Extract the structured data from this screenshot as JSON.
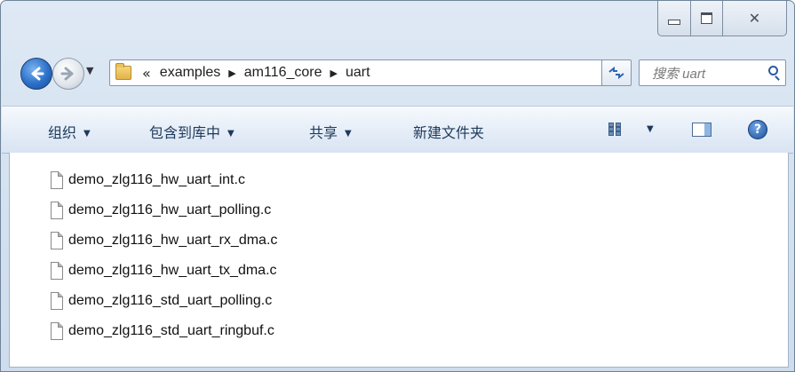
{
  "window": {
    "caption": {
      "minimize": "minimize",
      "maximize": "maximize",
      "close": "close"
    }
  },
  "address_bar": {
    "overflow": "«",
    "breadcrumbs": [
      "examples",
      "am116_core",
      "uart"
    ],
    "separator": "▶"
  },
  "search": {
    "placeholder": "搜索 uart"
  },
  "toolbar": {
    "organize": "组织",
    "include_in_library": "包含到库中",
    "share": "共享",
    "new_folder": "新建文件夹"
  },
  "files": [
    "demo_zlg116_hw_uart_int.c",
    "demo_zlg116_hw_uart_polling.c",
    "demo_zlg116_hw_uart_rx_dma.c",
    "demo_zlg116_hw_uart_tx_dma.c",
    "demo_zlg116_std_uart_polling.c",
    "demo_zlg116_std_uart_ringbuf.c"
  ],
  "icons": {
    "back": "back-arrow-icon",
    "forward": "forward-arrow-icon",
    "folder": "folder-icon",
    "refresh": "refresh-icon",
    "search": "search-icon",
    "views": "views-icon",
    "preview_pane": "preview-pane-icon",
    "help": "help-icon",
    "file": "c-file-icon"
  },
  "colors": {
    "accent": "#2b70c9",
    "toolbar_text": "#1e395b"
  }
}
